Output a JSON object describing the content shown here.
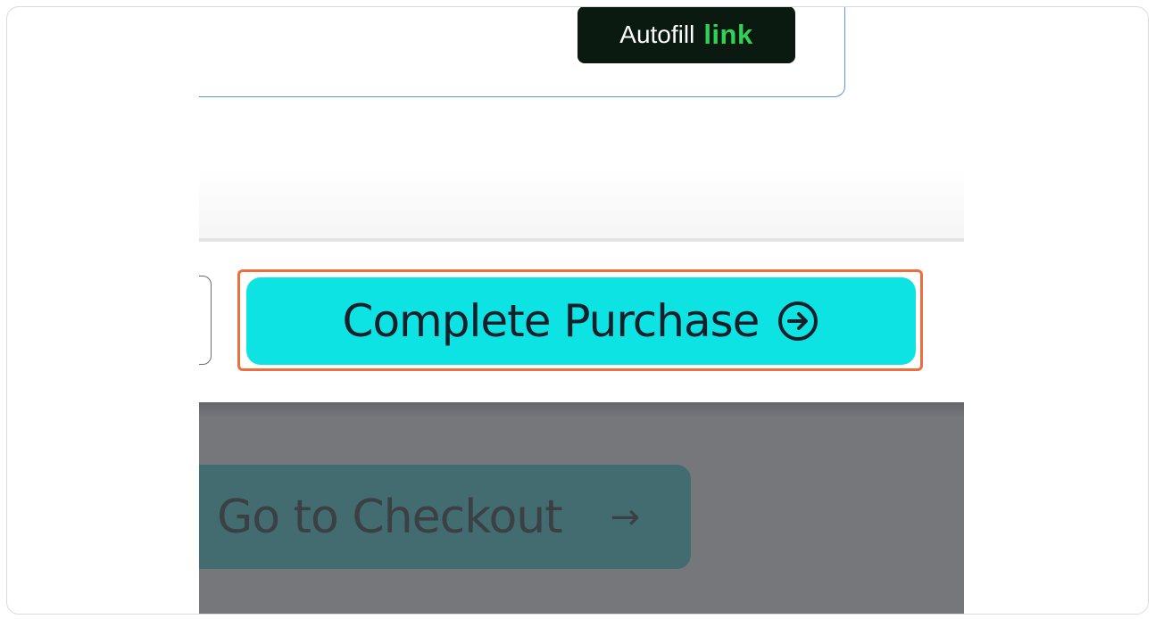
{
  "email_field": {
    "autofill_label": "Autofill",
    "autofill_brand": "link"
  },
  "checkout": {
    "complete_purchase_label": "Complete Purchase",
    "complete_purchase_icon": "circle-arrow-right-icon",
    "go_to_checkout_label": "Go to Checkout",
    "go_to_checkout_icon": "arrow-right-icon"
  },
  "colors": {
    "primary_button": "#0de3e3",
    "highlight_outline": "#ef6e3e",
    "autofill_bg": "#0b1a10",
    "link_brand": "#31d158",
    "overlay": "#76777b",
    "checkout_button": "#436c70"
  }
}
